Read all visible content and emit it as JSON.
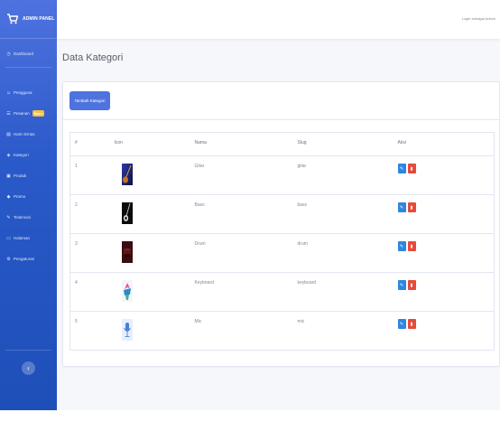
{
  "sidebar": {
    "brand": "ADMIN PANEL",
    "items": [
      {
        "icon": "dashboard-icon",
        "glyph": "◷",
        "label": "Dashboard"
      },
      {
        "icon": "users-icon",
        "glyph": "☺",
        "label": "Pengguna"
      },
      {
        "icon": "orders-icon",
        "glyph": "☰",
        "label": "Pesanan",
        "badge": "Baru"
      },
      {
        "icon": "product-list-icon",
        "glyph": "▤",
        "label": "Harin Emas"
      },
      {
        "icon": "tag-icon",
        "glyph": "◈",
        "label": "Kategori"
      },
      {
        "icon": "box-icon",
        "glyph": "▣",
        "label": "Produk"
      },
      {
        "icon": "promo-icon",
        "glyph": "◆",
        "label": "Promo"
      },
      {
        "icon": "testimonial-icon",
        "glyph": "✎",
        "label": "Testimoni"
      },
      {
        "icon": "page-icon",
        "glyph": "▭",
        "label": "Halaman"
      },
      {
        "icon": "settings-icon",
        "glyph": "⚙",
        "label": "Pengaturan"
      }
    ],
    "toggle_glyph": "‹"
  },
  "topbar": {
    "user_text": "Login sebagai Admin"
  },
  "page": {
    "title": "Data Kategori"
  },
  "card": {
    "add_button": "Tambah Kategori"
  },
  "table": {
    "headers": [
      "#",
      "Icon",
      "Nama",
      "Slug",
      "Aksi"
    ],
    "rows": [
      {
        "no": "1",
        "icon": "guitar-image",
        "nama": "Gitar",
        "slug": "gitar"
      },
      {
        "no": "2",
        "icon": "bass-image",
        "nama": "Bass",
        "slug": "bass"
      },
      {
        "no": "3",
        "icon": "drum-image",
        "nama": "Drum",
        "slug": "drum"
      },
      {
        "no": "4",
        "icon": "keyboard-image",
        "nama": "Keyboard",
        "slug": "keyboard"
      },
      {
        "no": "5",
        "icon": "mic-image",
        "nama": "Mic",
        "slug": "mic"
      }
    ],
    "edit_glyph": "✎",
    "delete_glyph": "▮"
  },
  "colors": {
    "sidebar": "#2a59c9",
    "primary": "#4e73df",
    "danger": "#e74a3b",
    "badge": "#f6c23e"
  }
}
